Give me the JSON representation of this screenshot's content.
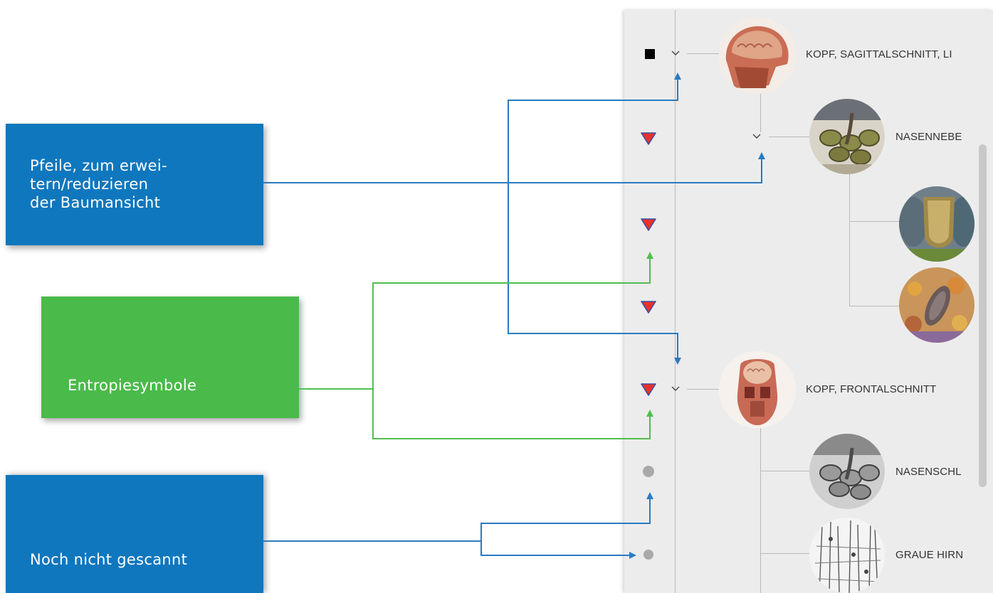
{
  "callouts": {
    "arrows": "Pfeile, zum erwei-\ntern/reduzieren\nder Baumansicht",
    "entropy": "Entropiesymbole",
    "not_scanned": "Noch nicht gescannt"
  },
  "colors": {
    "callout_blue": "#0f77bd",
    "callout_green": "#4aba4a",
    "connector_blue": "#2a7bc0",
    "connector_green": "#4fbf4f",
    "entropy_red": "#e8312c",
    "entropy_border": "#3a4ea0",
    "panel_bg": "#ececec"
  },
  "tree": {
    "nodes": [
      {
        "label": "KOPF, SAGITTALSCHNITT, LI",
        "status": "square",
        "icon": "head-sagittal-thumbnail"
      },
      {
        "label": "NASENNEBE",
        "status": "entropy",
        "icon": "nasal-tissue-thumbnail"
      },
      {
        "label": "",
        "status": "entropy",
        "icon": "cell-blue-thumbnail"
      },
      {
        "label": "",
        "status": "entropy",
        "icon": "cell-orange-thumbnail"
      },
      {
        "label": "KOPF, FRONTALSCHNITT",
        "status": "entropy",
        "icon": "head-frontal-thumbnail"
      },
      {
        "label": "NASENSCHL",
        "status": "not-scanned",
        "icon": "nasal-mucosa-gray-thumbnail"
      },
      {
        "label": "GRAUE HIRN",
        "status": "not-scanned",
        "icon": "gray-matter-thumbnail"
      }
    ]
  }
}
